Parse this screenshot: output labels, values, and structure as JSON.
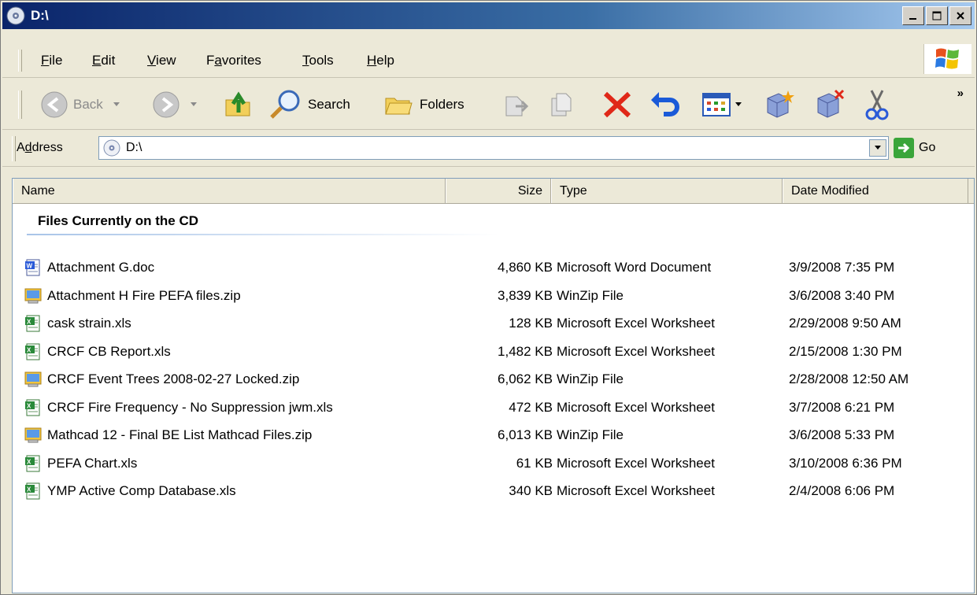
{
  "window": {
    "title": "D:\\"
  },
  "menu": {
    "items": [
      {
        "label": "File",
        "underline": "F",
        "rest": "ile"
      },
      {
        "label": "Edit",
        "underline": "E",
        "rest": "dit"
      },
      {
        "label": "View",
        "underline": "V",
        "rest": "iew"
      },
      {
        "label": "Favorites",
        "pre": "F",
        "underline": "a",
        "rest": "vorites"
      },
      {
        "label": "Tools",
        "underline": "T",
        "rest": "ools"
      },
      {
        "label": "Help",
        "underline": "H",
        "rest": "elp"
      }
    ]
  },
  "toolbar": {
    "back_label": "Back",
    "search_label": "Search",
    "folders_label": "Folders",
    "more": "»"
  },
  "address": {
    "label_pre": "A",
    "label_u": "d",
    "label_rest": "dress",
    "value": "D:\\",
    "go_label": "Go"
  },
  "columns": {
    "name": "Name",
    "size": "Size",
    "type": "Type",
    "date": "Date Modified"
  },
  "group_title": "Files Currently on the CD",
  "files": [
    {
      "name": "Attachment G.doc",
      "size": "4,860 KB",
      "type": "Microsoft Word Document",
      "date": "3/9/2008 7:35 PM",
      "icon": "word-icon"
    },
    {
      "name": "Attachment H Fire PEFA files.zip",
      "size": "3,839 KB",
      "type": "WinZip File",
      "date": "3/6/2008 3:40 PM",
      "icon": "zip-icon"
    },
    {
      "name": "cask strain.xls",
      "size": "128 KB",
      "type": "Microsoft Excel Worksheet",
      "date": "2/29/2008 9:50 AM",
      "icon": "excel-icon"
    },
    {
      "name": "CRCF CB Report.xls",
      "size": "1,482 KB",
      "type": "Microsoft Excel Worksheet",
      "date": "2/15/2008 1:30 PM",
      "icon": "excel-icon"
    },
    {
      "name": "CRCF Event Trees 2008-02-27 Locked.zip",
      "size": "6,062 KB",
      "type": "WinZip File",
      "date": "2/28/2008 12:50 AM",
      "icon": "zip-icon"
    },
    {
      "name": "CRCF Fire Frequency - No Suppression jwm.xls",
      "size": "472 KB",
      "type": "Microsoft Excel Worksheet",
      "date": "3/7/2008 6:21 PM",
      "icon": "excel-icon"
    },
    {
      "name": "Mathcad 12 -  Final BE List Mathcad Files.zip",
      "size": "6,013 KB",
      "type": "WinZip File",
      "date": "3/6/2008 5:33 PM",
      "icon": "zip-icon"
    },
    {
      "name": "PEFA Chart.xls",
      "size": "61 KB",
      "type": "Microsoft Excel Worksheet",
      "date": "3/10/2008 6:36 PM",
      "icon": "excel-icon"
    },
    {
      "name": "YMP Active Comp Database.xls",
      "size": "340 KB",
      "type": "Microsoft Excel Worksheet",
      "date": "2/4/2008 6:06 PM",
      "icon": "excel-icon"
    }
  ]
}
